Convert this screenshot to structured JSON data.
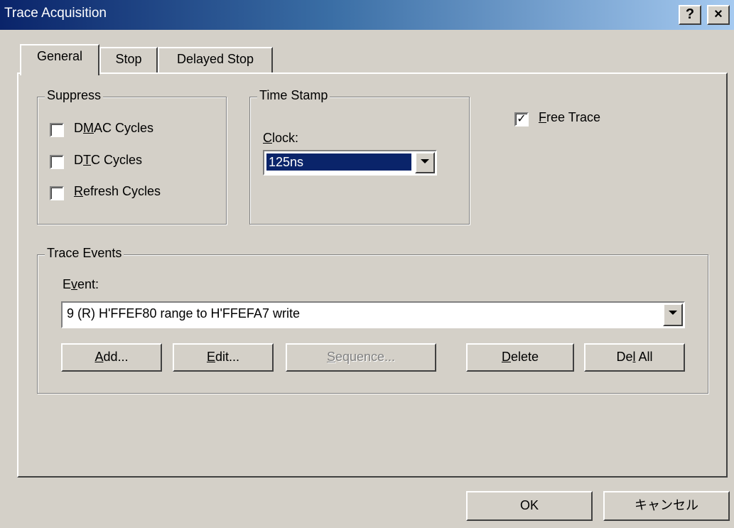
{
  "window": {
    "title": "Trace Acquisition",
    "help_label": "?",
    "close_label": "×"
  },
  "tabs": [
    {
      "label": "General",
      "active": true
    },
    {
      "label": "Stop",
      "active": false
    },
    {
      "label": "Delayed Stop",
      "active": false
    }
  ],
  "suppress": {
    "label": "Suppress",
    "items": [
      {
        "pre": "D",
        "mn": "M",
        "post": "AC Cycles",
        "checked": false
      },
      {
        "pre": "D",
        "mn": "T",
        "post": "C Cycles",
        "checked": false
      },
      {
        "pre": "",
        "mn": "R",
        "post": "efresh Cycles",
        "checked": false
      }
    ]
  },
  "timestamp": {
    "label": "Time Stamp",
    "clock_mn": "C",
    "clock_rest": "lock:",
    "clock_value": "125ns"
  },
  "free_trace": {
    "mn": "F",
    "rest": "ree Trace",
    "checked": true,
    "check_mark": "✓"
  },
  "trace_events": {
    "label": "Trace Events",
    "event_pre": "E",
    "event_mn": "v",
    "event_post": "ent:",
    "event_value": "9 (R) H'FFEF80 range to H'FFEFA7 write",
    "buttons": {
      "add_mn": "A",
      "add_rest": "dd...",
      "edit_mn": "E",
      "edit_rest": "dit...",
      "seq_mn": "S",
      "seq_rest": "equence...",
      "delete_mn": "D",
      "delete_rest": "elete",
      "delall_pre": "De",
      "delall_mn": "l",
      "delall_post": " All"
    }
  },
  "footer": {
    "ok_label": "OK",
    "cancel_label": "キャンセル"
  }
}
